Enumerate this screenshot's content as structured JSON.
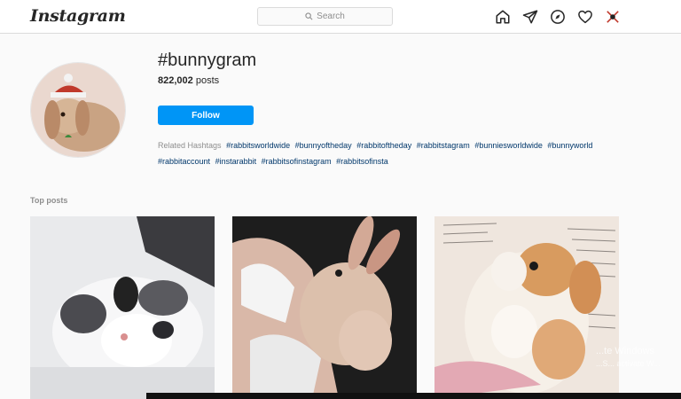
{
  "nav": {
    "logo": "Instagram",
    "search_placeholder": "Search",
    "icons": [
      "home-icon",
      "direct-icon",
      "explore-icon",
      "activity-heart-icon",
      "profile-avatar-icon"
    ]
  },
  "header": {
    "hashtag": "#bunnygram",
    "post_count": "822,002",
    "post_count_suffix": "posts",
    "follow_label": "Follow",
    "related_label": "Related Hashtags",
    "related_tags": [
      "#rabbitsworldwide",
      "#bunnyoftheday",
      "#rabbitoftheday",
      "#rabbitstagram",
      "#bunniesworldwide",
      "#bunnyworld",
      "#rabbitaccount",
      "#instarabbit",
      "#rabbitsofinstagram",
      "#rabbitsofinsta"
    ]
  },
  "top_posts": {
    "label": "Top posts"
  },
  "watermark": {
    "line1": "...te Windows",
    "line2": "...S... activate W..."
  },
  "colors": {
    "accent": "#0095f6",
    "link": "#00376b",
    "muted": "#8e8e8e",
    "border": "#dbdbdb"
  }
}
